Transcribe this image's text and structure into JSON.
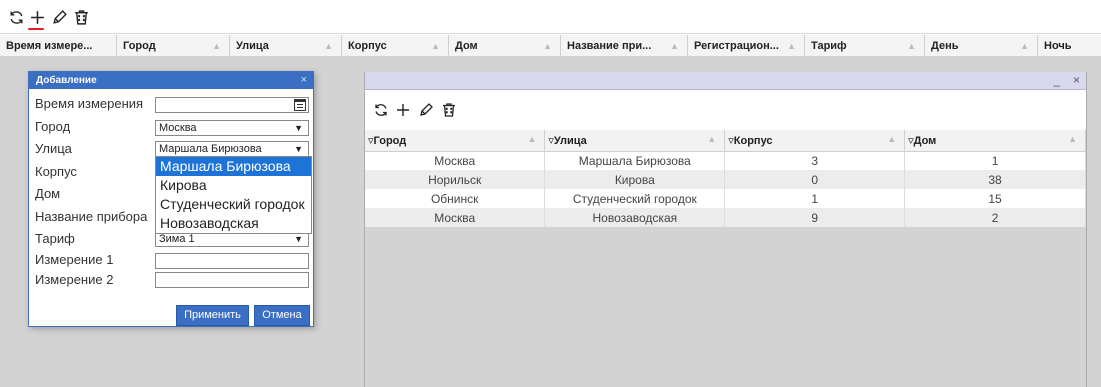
{
  "toolbar": {
    "icons": [
      "refresh-icon",
      "add-icon",
      "edit-icon",
      "delete-icon"
    ]
  },
  "grid": {
    "columns": [
      "Время измере...",
      "Город",
      "Улица",
      "Корпус",
      "Дом",
      "Название при...",
      "Регистрацион...",
      "Тариф",
      "День",
      "Ночь"
    ]
  },
  "dialog": {
    "title": "Добавление",
    "close": "×",
    "labels": {
      "time": "Время измерения",
      "city": "Город",
      "street": "Улица",
      "building": "Корпус",
      "house": "Дом",
      "device": "Название прибора",
      "tariff": "Тариф",
      "measure1": "Измерение 1",
      "measure2": "Измерение 2"
    },
    "values": {
      "time": "",
      "city": "Москва",
      "street": "Маршала Бирюзова",
      "tariff": "Зима 1",
      "measure1": "",
      "measure2": ""
    },
    "street_options": [
      "Маршала Бирюзова",
      "Кирова",
      "Студенческий городок",
      "Новозаводская"
    ],
    "apply_label": "Применить",
    "cancel_label": "Отмена"
  },
  "panel": {
    "minimize": "_",
    "close": "×",
    "columns": [
      "Город",
      "Улица",
      "Корпус",
      "Дом"
    ],
    "rows": [
      [
        "Москва",
        "Маршала Бирюзова",
        "3",
        "1"
      ],
      [
        "Норильск",
        "Кирова",
        "0",
        "38"
      ],
      [
        "Обнинск",
        "Студенческий городок",
        "1",
        "15"
      ],
      [
        "Москва",
        "Новозаводская",
        "9",
        "2"
      ]
    ]
  },
  "colors": {
    "accent": "#3a6fc4",
    "selected": "#1e73d6",
    "underline": "#e02020",
    "panel_title": "#d7d7ee",
    "background": "#d3d3d3"
  }
}
